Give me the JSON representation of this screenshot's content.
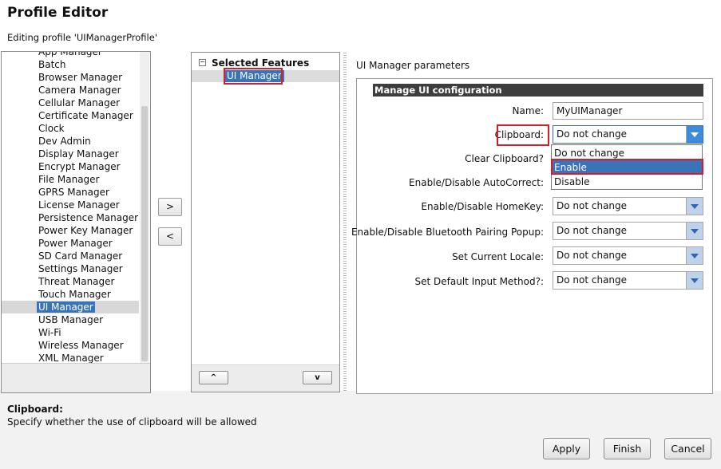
{
  "header": {
    "title": "Profile Editor",
    "subtitle": "Editing profile 'UIManagerProfile'"
  },
  "available_features": {
    "items": [
      "App Manager",
      "Batch",
      "Browser Manager",
      "Camera Manager",
      "Cellular Manager",
      "Certificate Manager",
      "Clock",
      "Dev Admin",
      "Display Manager",
      "Encrypt Manager",
      "File Manager",
      "GPRS Manager",
      "License Manager",
      "Persistence Manager",
      "Power Key Manager",
      "Power Manager",
      "SD Card Manager",
      "Settings Manager",
      "Threat Manager",
      "Touch Manager",
      "UI Manager",
      "USB Manager",
      "Wi-Fi",
      "Wireless Manager",
      "XML Manager"
    ],
    "selected": "UI Manager"
  },
  "move_buttons": {
    "add": ">",
    "remove": "<"
  },
  "selected_features": {
    "header": "Selected Features",
    "toggle": "−",
    "items": [
      "UI Manager"
    ],
    "up_label": "^",
    "down_label": "v"
  },
  "params": {
    "title": "UI Manager parameters",
    "section": "Manage UI configuration",
    "name_label": "Name:",
    "name_value": "MyUIManager",
    "clipboard_label": "Clipboard:",
    "clipboard_value": "Do not change",
    "clear_clipboard_label": "Clear Clipboard?",
    "autocorrect_label": "Enable/Disable AutoCorrect:",
    "homekey_label": "Enable/Disable HomeKey:",
    "homekey_value": "Do not change",
    "bluetooth_label": "Enable/Disable Bluetooth Pairing Popup:",
    "bluetooth_value": "Do not change",
    "locale_label": "Set Current Locale:",
    "locale_value": "Do not change",
    "input_method_label": "Set Default Input Method?:",
    "input_method_value": "Do not change",
    "clipboard_options": [
      "Do not change",
      "Enable",
      "Disable"
    ],
    "highlighted_option": "Enable"
  },
  "help": {
    "title": "Clipboard:",
    "text": "Specify whether the use of clipboard will be allowed"
  },
  "footer": {
    "apply": "Apply",
    "finish": "Finish",
    "cancel": "Cancel"
  },
  "colors": {
    "selection": "#3a73b8",
    "highlight_box": "#d21f2c",
    "section_bar": "#3d3d3d"
  }
}
